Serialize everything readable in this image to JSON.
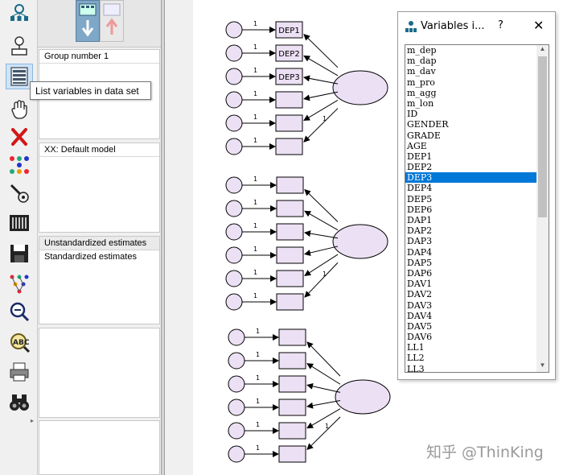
{
  "tooltip": {
    "text": "List variables in data set"
  },
  "panels": {
    "groups": {
      "header": "Group number 1"
    },
    "models": {
      "header": "XX: Default model"
    },
    "estimates": {
      "items": [
        "Unstandardized estimates",
        "Standardized estimates"
      ]
    }
  },
  "variables_window": {
    "title": "Variables i...",
    "help": "?",
    "close": "✕",
    "items": [
      "m_dep",
      "m_dap",
      "m_dav",
      "m_pro",
      "m_agg",
      "m_lon",
      "ID",
      "GENDER",
      "GRADE",
      "AGE",
      "DEP1",
      "DEP2",
      "DEP3",
      "DEP4",
      "DEP5",
      "DEP6",
      "DAP1",
      "DAP2",
      "DAP3",
      "DAP4",
      "DAP5",
      "DAP6",
      "DAV1",
      "DAV2",
      "DAV3",
      "DAV4",
      "DAV5",
      "DAV6",
      "LL1",
      "LL2",
      "LL3"
    ],
    "selected": "DEP3"
  },
  "diagram": {
    "observed_labels": [
      "DEP1",
      "DEP2",
      "DEP3"
    ],
    "path_label": "1"
  },
  "watermark": "知乎 @ThinKing",
  "colors": {
    "node_fill": "#ece0f4",
    "selection": "#0078d7",
    "active_tool": "#cfe3f7"
  }
}
